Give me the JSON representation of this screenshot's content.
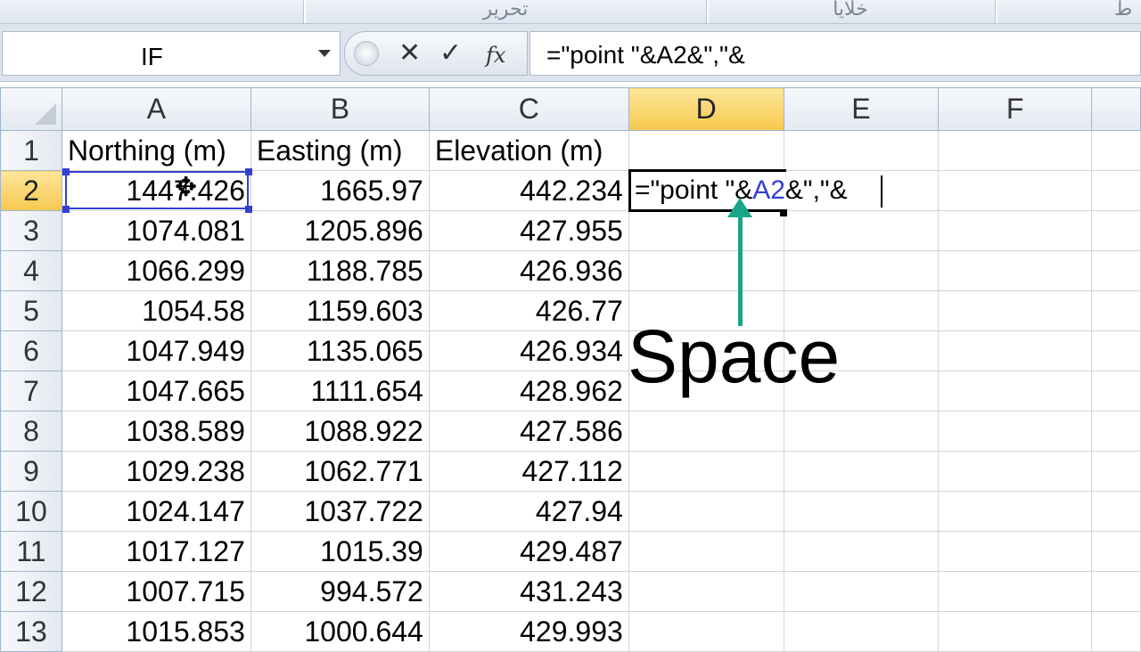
{
  "ribbon": {
    "group_center_label": "تحرير",
    "group_right_label": "خلايا",
    "group_edge_label": "ط"
  },
  "formula_bar": {
    "name_box": "IF",
    "cancel_glyph": "✕",
    "enter_glyph": "✓",
    "fx_glyph": "fx",
    "formula": "=\"point \"&A2&\",\"&"
  },
  "columns": [
    "A",
    "B",
    "C",
    "D",
    "E",
    "F"
  ],
  "active_column": "D",
  "active_row": "2",
  "rows": [
    {
      "row": "1",
      "a": "Northing (m)",
      "b": "Easting (m)",
      "c": "Elevation (m)"
    },
    {
      "row": "2",
      "a": "1447.426",
      "b": "1665.97",
      "c": "442.234"
    },
    {
      "row": "3",
      "a": "1074.081",
      "b": "1205.896",
      "c": "427.955"
    },
    {
      "row": "4",
      "a": "1066.299",
      "b": "1188.785",
      "c": "426.936"
    },
    {
      "row": "5",
      "a": "1054.58",
      "b": "1159.603",
      "c": "426.77"
    },
    {
      "row": "6",
      "a": "1047.949",
      "b": "1135.065",
      "c": "426.934"
    },
    {
      "row": "7",
      "a": "1047.665",
      "b": "1111.654",
      "c": "428.962"
    },
    {
      "row": "8",
      "a": "1038.589",
      "b": "1088.922",
      "c": "427.586"
    },
    {
      "row": "9",
      "a": "1029.238",
      "b": "1062.771",
      "c": "427.112"
    },
    {
      "row": "10",
      "a": "1024.147",
      "b": "1037.722",
      "c": "427.94"
    },
    {
      "row": "11",
      "a": "1017.127",
      "b": "1015.39",
      "c": "429.487"
    },
    {
      "row": "12",
      "a": "1007.715",
      "b": "994.572",
      "c": "431.243"
    },
    {
      "row": "13",
      "a": "1015.853",
      "b": "1000.644",
      "c": "429.993"
    }
  ],
  "edit_cell": {
    "prefix": "=\"point \"&",
    "ref": "A2",
    "suffix": "&\",\"&"
  },
  "annotation": {
    "label": "Space",
    "color": "#1aa58a"
  },
  "colors": {
    "selection": "#3340d0",
    "active_header": "#f6c94f"
  }
}
